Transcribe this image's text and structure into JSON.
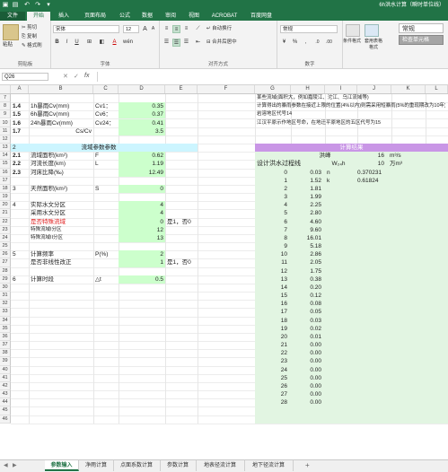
{
  "window": {
    "title": "6h洪水计算（瞬时单位线）",
    "controls": [
      "▣",
      "↶",
      "↷",
      "▾"
    ]
  },
  "ribbon_tabs": [
    "文件",
    "开始",
    "插入",
    "页面布局",
    "公式",
    "数据",
    "审阅",
    "视图",
    "ACROBAT",
    "百度网盘"
  ],
  "clipboard": {
    "paste": "粘贴",
    "cut": "剪切",
    "copy": "复制",
    "painter": "格式刷",
    "label": "剪贴板"
  },
  "font": {
    "name": "宋体",
    "size": "12",
    "grow": "A",
    "shrink": "A",
    "bold": "B",
    "italic": "I",
    "underline": "U",
    "label": "字体",
    "wen": "wén"
  },
  "alignment": {
    "wrap": "自动换行",
    "merge": "合并后居中",
    "label": "对齐方式"
  },
  "number": {
    "format": "常规",
    "label": "数字",
    "pct": "%",
    "comma": ",",
    "inc": ".0",
    "dec": ".00"
  },
  "styles": {
    "cond": "条件格式",
    "table": "套用表格格式",
    "normal": "常规",
    "check": "检查单元格"
  },
  "formula_bar": {
    "namebox": "Q26",
    "cancel": "✕",
    "enter": "✓",
    "fx": "fx",
    "value": ""
  },
  "columns": [
    "A",
    "B",
    "C",
    "D",
    "E",
    "F",
    "G",
    "H",
    "I",
    "J",
    "K",
    "L"
  ],
  "notes": {
    "line1": "某些流域(面积大，例如嘉陵江、沱江、乌江流域等)",
    "line1b": "计算得出的暴雨参数在接近上限的位置(4%以内)则需采用短暴雨(5%的重现期改为10年)。",
    "line2": "岩溶地区代号14",
    "line3": "江汉平原示作地区号命，在地迁平原地区的五区代号为15"
  },
  "rows": [
    {
      "n": "7",
      "a": "",
      "b": "",
      "c": "",
      "d": "",
      "e": ""
    },
    {
      "n": "8",
      "a": "1.4",
      "b": "1h暴雨Cv(mm)",
      "c": "Cv1：",
      "d": "0.35"
    },
    {
      "n": "9",
      "a": "1.5",
      "b": "6h暴雨Cv(mm)",
      "c": "Cv6：",
      "d": "0.37"
    },
    {
      "n": "10",
      "a": "1.6",
      "b": "24h暴雨Cv(mm)",
      "c": "Cv24：",
      "d": "0.41"
    },
    {
      "n": "11",
      "a": "1.7",
      "b": "Cs/Cv",
      "c": "",
      "d": "3.5"
    },
    {
      "n": "12"
    },
    {
      "n": "13",
      "a": "2",
      "b": "流域参数参数"
    },
    {
      "n": "14",
      "a": "2.1",
      "b": "流域面积(km²)",
      "c": "F",
      "d": "0.62"
    },
    {
      "n": "15",
      "a": "2.2",
      "b": "河流长度(km)",
      "c": "L",
      "d": "1.19"
    },
    {
      "n": "16",
      "a": "2.3",
      "b": "河床比降(‰)",
      "c": "",
      "d": "12.49"
    },
    {
      "n": "17"
    },
    {
      "n": "18",
      "a": "3",
      "b": "天然面积(km²)",
      "c": "S",
      "d": "0"
    },
    {
      "n": "19"
    },
    {
      "n": "20",
      "a": "4",
      "b": "实际水文分区",
      "c": "",
      "d": "4"
    },
    {
      "n": "21",
      "a": "",
      "b": "采用水文分区",
      "c": "",
      "d": "4"
    },
    {
      "n": "22",
      "a": "",
      "b": "是否特殊流域",
      "c": "",
      "d": "0",
      "e": "是1，否0"
    },
    {
      "n": "23",
      "a": "",
      "b": "特殊流域I分区",
      "c": "",
      "d": "12"
    },
    {
      "n": "24",
      "a": "",
      "b": "特殊流域II分区",
      "c": "",
      "d": "13"
    },
    {
      "n": "25"
    },
    {
      "n": "26",
      "a": "5",
      "b": "计算频率",
      "c": "P(%)",
      "d": "2"
    },
    {
      "n": "27",
      "a": "",
      "b": "是否非线性改正",
      "c": "",
      "d": "1",
      "e": "是1，否0"
    },
    {
      "n": "28"
    },
    {
      "n": "29",
      "a": "6",
      "b": "计算时段",
      "c": "△t",
      "d": "0.5"
    }
  ],
  "extra_rows": [
    "30",
    "31",
    "32",
    "33",
    "34",
    "35",
    "36",
    "37",
    "38",
    "39",
    "40",
    "41",
    "42",
    "43",
    "44",
    "45",
    "46"
  ],
  "results": {
    "title": "计算结果",
    "peak_label": "洪峰",
    "peak_value": "16",
    "peak_unit": "m³/s",
    "vol_label": "W₂₄h",
    "vol_value": "10",
    "vol_unit": "万m³",
    "process_label": "设计洪水过程线",
    "n_label": "n",
    "n_value": "0.370231",
    "k_label": "k",
    "k_value": "0.61824",
    "hydrograph": [
      [
        "0",
        "0.03"
      ],
      [
        "1",
        "1.52"
      ],
      [
        "2",
        "1.81"
      ],
      [
        "3",
        "1.99"
      ],
      [
        "4",
        "2.25"
      ],
      [
        "5",
        "2.80"
      ],
      [
        "6",
        "4.60"
      ],
      [
        "7",
        "9.60"
      ],
      [
        "8",
        "16.01"
      ],
      [
        "9",
        "5.18"
      ],
      [
        "10",
        "2.86"
      ],
      [
        "11",
        "2.05"
      ],
      [
        "12",
        "1.75"
      ],
      [
        "13",
        "0.38"
      ],
      [
        "14",
        "0.20"
      ],
      [
        "15",
        "0.12"
      ],
      [
        "16",
        "0.08"
      ],
      [
        "17",
        "0.05"
      ],
      [
        "18",
        "0.03"
      ],
      [
        "19",
        "0.02"
      ],
      [
        "20",
        "0.01"
      ],
      [
        "21",
        "0.00"
      ],
      [
        "22",
        "0.00"
      ],
      [
        "23",
        "0.00"
      ],
      [
        "24",
        "0.00"
      ],
      [
        "25",
        "0.00"
      ],
      [
        "26",
        "0.00"
      ],
      [
        "27",
        "0.00"
      ],
      [
        "28",
        "0.00"
      ]
    ]
  },
  "sheet_tabs": [
    "参数输入",
    "净雨计算",
    "点面系数计算",
    "参数计算",
    "地表径流计算",
    "地下径流计算"
  ],
  "sheet_nav": {
    "prev": "◀",
    "next": "▶",
    "add": "+"
  }
}
